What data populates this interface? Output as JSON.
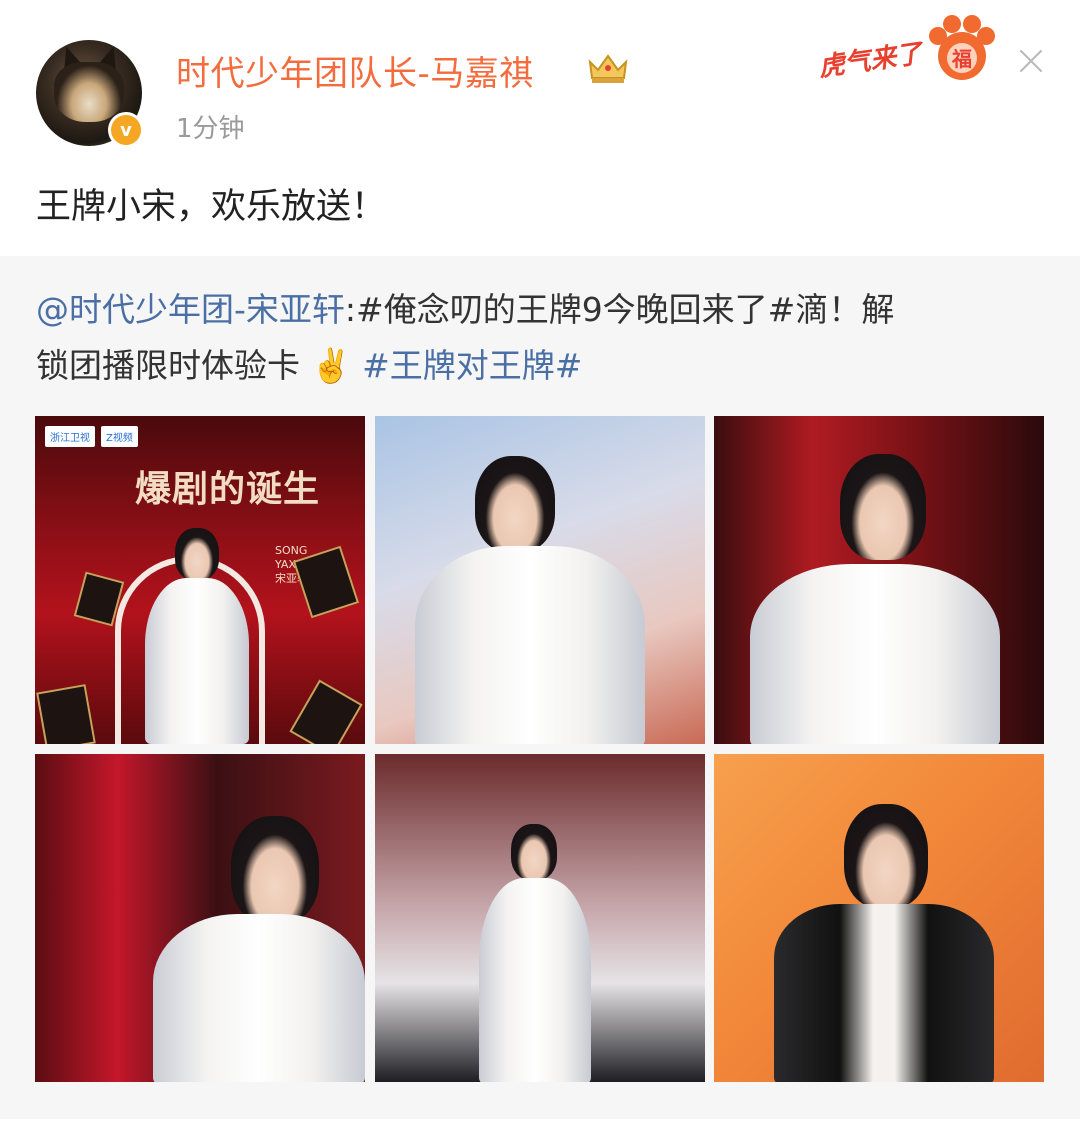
{
  "header": {
    "username": "时代少年团队长-马嘉祺",
    "timestamp": "1分钟",
    "badge_text": "虎气来了",
    "badge_paw_char": "福"
  },
  "post": {
    "text": "王牌小宋，欢乐放送！"
  },
  "repost": {
    "mention": "@时代少年团-宋亚轩",
    "body_part1": ":#俺念叨的王牌9今晚回来了#滴！解",
    "body_part2": "锁团播限时体验卡",
    "emoji": "✌️",
    "topic": "#王牌对王牌#"
  },
  "poster": {
    "title": "爆剧的诞生",
    "logo1": "浙江卫视",
    "logo2": "Z视频",
    "side_text": "SONG YAXUAN 宋亚轩"
  },
  "colors": {
    "username": "#f36c3d",
    "link": "#4a6fa5",
    "verified": "#f5a623",
    "badge": "#e8402e",
    "repost_bg": "#f6f6f6"
  },
  "icons": [
    "crown-icon",
    "verified-icon",
    "close-icon",
    "paw-badge-icon"
  ]
}
